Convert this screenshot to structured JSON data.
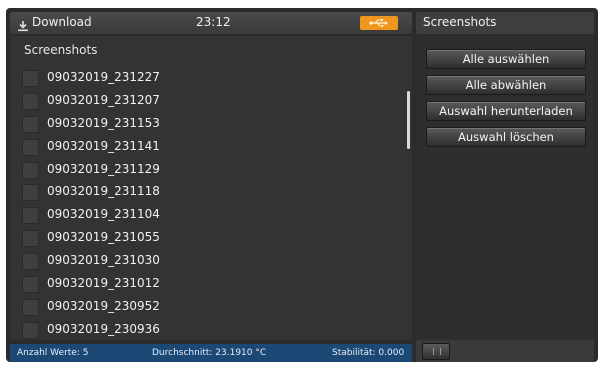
{
  "topbar": {
    "title": "Download",
    "time": "23:12",
    "usb_icon": "usb-icon",
    "usb_color": "#f0951e"
  },
  "left": {
    "title": "Screenshots",
    "files": [
      "09032019_231227",
      "09032019_231207",
      "09032019_231153",
      "09032019_231141",
      "09032019_231129",
      "09032019_231118",
      "09032019_231104",
      "09032019_231055",
      "09032019_231030",
      "09032019_231012",
      "09032019_230952",
      "09032019_230936"
    ]
  },
  "status": {
    "count": "Anzahl Werte: 5",
    "average": "Durchschnitt: 23.1910 °C",
    "stability": "Stabilität: 0.000",
    "color": "#1c4876"
  },
  "right": {
    "title": "Screenshots",
    "buttons": {
      "select_all": "Alle auswählen",
      "deselect_all": "Alle abwählen",
      "download_selection": "Auswahl herunterladen",
      "delete_selection": "Auswahl löschen"
    }
  }
}
